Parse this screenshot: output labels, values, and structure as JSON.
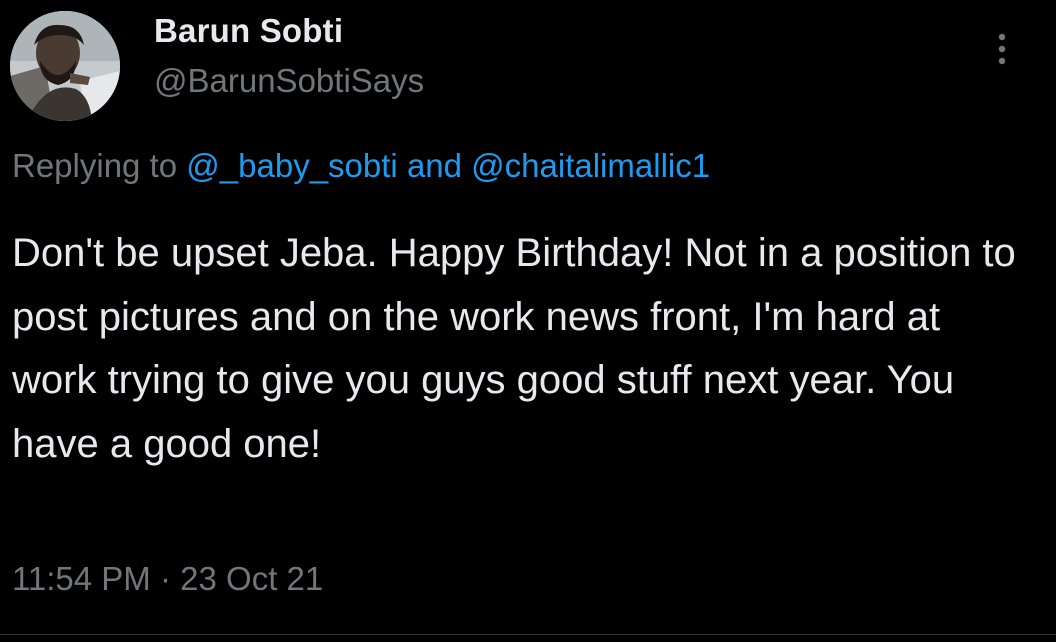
{
  "tweet": {
    "author": {
      "display_name": "Barun Sobti",
      "handle": "@BarunSobtiSays",
      "avatar_icon": "profile-photo-avatar"
    },
    "more_icon": "more-vertical-icon",
    "reply_context": {
      "prefix": "Replying to",
      "mention_1": "@_baby_sobti",
      "conjunction": "and",
      "mention_2": "@chaitalimallic1"
    },
    "text": "Don't be upset Jeba. Happy Birthday! Not in a position to post pictures and on the work news front, I'm hard at work trying to give you guys good stuff next year. You have a good one!",
    "time": "11:54 PM",
    "separator": "·",
    "date": "23 Oct 21"
  },
  "colors": {
    "background": "#000000",
    "primary_text": "#e7e9ea",
    "secondary_text": "#71767b",
    "accent_link": "#1d9bf0"
  }
}
